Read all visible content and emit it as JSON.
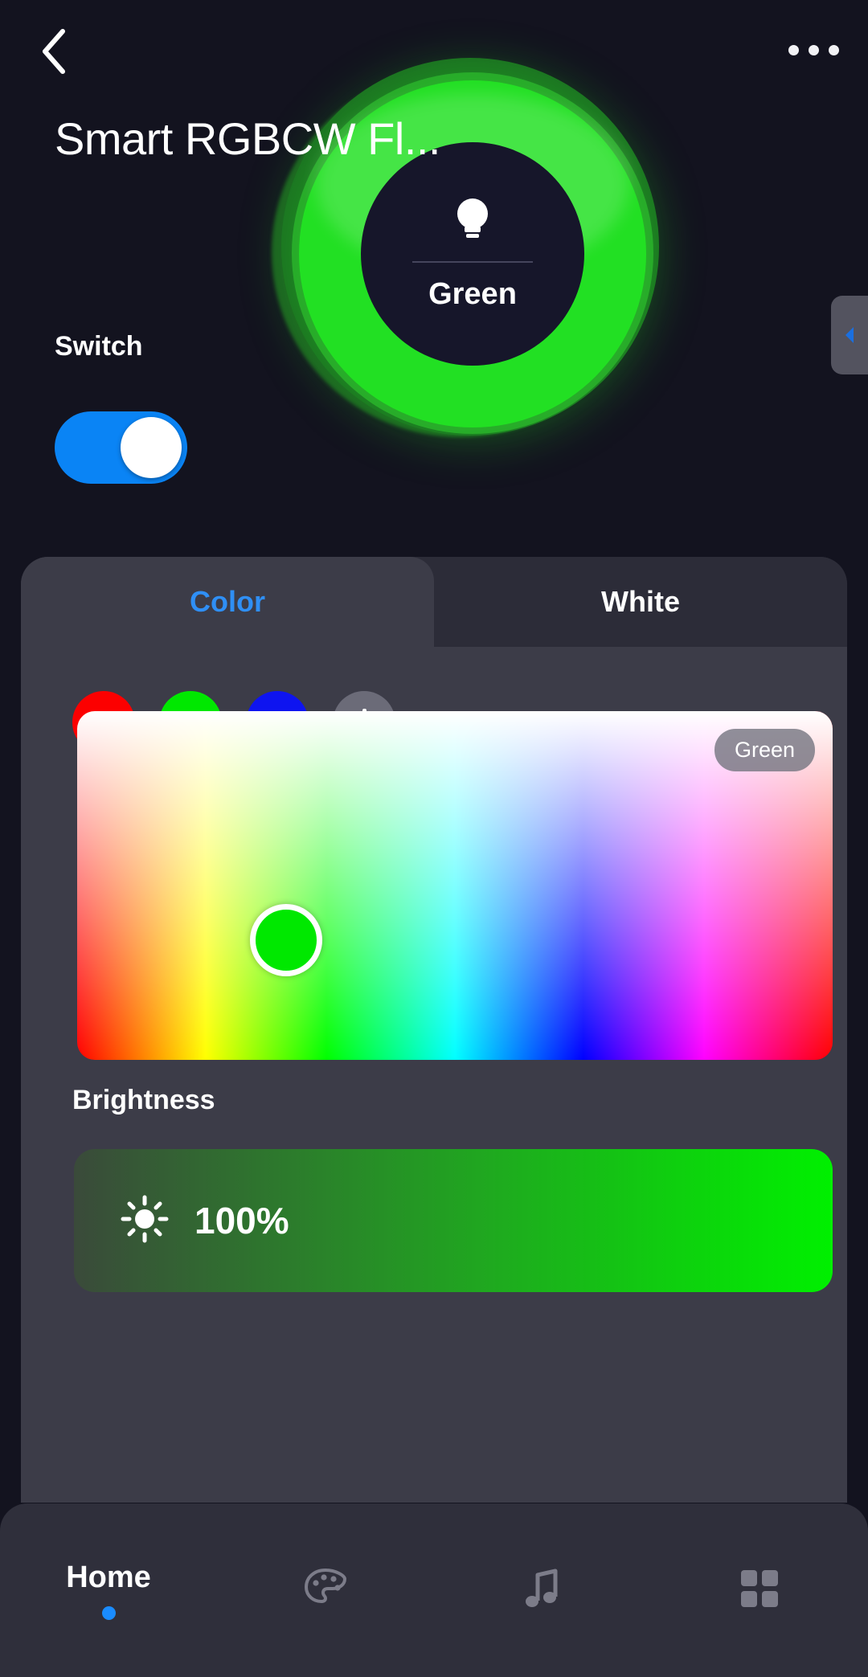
{
  "header": {
    "back_icon": "chevron-left-icon",
    "more_icon": "more-horizontal-icon",
    "title": "Smart RGBCW Fl..."
  },
  "lamp": {
    "bulb_icon": "lightbulb-icon",
    "state_label": "Green",
    "ring_color": "#22e023",
    "glow_color": "#1c6b22"
  },
  "side_tab": {
    "icon": "chevron-left-small-icon"
  },
  "switch": {
    "label": "Switch",
    "state": "on",
    "accent": "#0a84f5"
  },
  "panel": {
    "tabs": [
      {
        "label": "Color",
        "active": true,
        "color": "#2f8ff5"
      },
      {
        "label": "White",
        "active": false,
        "color": "#ffffff"
      }
    ],
    "swatches": [
      {
        "name": "red",
        "color": "#fc0000"
      },
      {
        "name": "green",
        "color": "#00e800"
      },
      {
        "name": "blue",
        "color": "#0e14f0"
      },
      {
        "name": "add",
        "color": "#6b6b78",
        "icon": "plus-icon"
      }
    ],
    "picker": {
      "chip_label": "Green",
      "handle_color": "#00e800",
      "handle_x_pct": 26,
      "handle_y_pct": 62
    },
    "brightness": {
      "label": "Brightness",
      "icon": "sun-icon",
      "value": "100%",
      "percent": 100
    }
  },
  "bottom_nav": [
    {
      "name": "home",
      "label": "Home",
      "icon": "home-text",
      "active": true
    },
    {
      "name": "scene",
      "label": "",
      "icon": "palette-icon",
      "active": false
    },
    {
      "name": "music",
      "label": "",
      "icon": "music-note-icon",
      "active": false
    },
    {
      "name": "grid",
      "label": "",
      "icon": "grid-icon",
      "active": false
    }
  ]
}
